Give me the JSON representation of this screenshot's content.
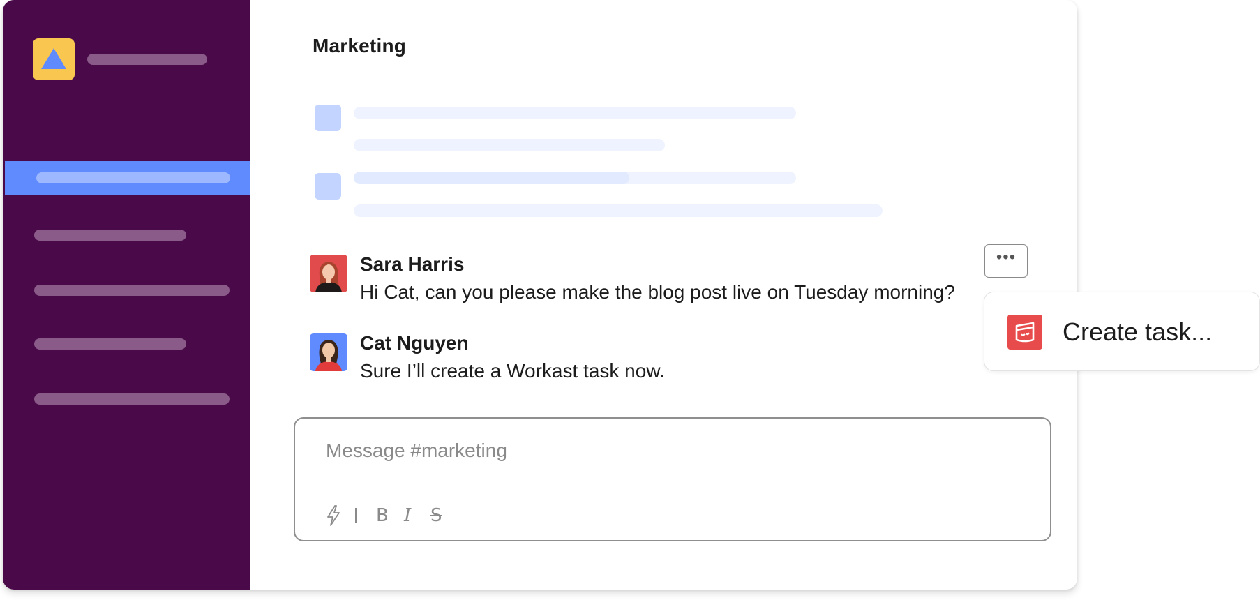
{
  "channel": {
    "title": "Marketing"
  },
  "messages": [
    {
      "author": "Sara Harris",
      "text": "Hi Cat, can you please make the blog post live on Tuesday morning?",
      "avatar_bg": "#e14b4b"
    },
    {
      "author": "Cat Nguyen",
      "text": "Sure I’ll create a Workast task now.",
      "avatar_bg": "#5f8bff"
    }
  ],
  "more_actions": {
    "label": "•••",
    "icon": "more-horizontal-icon"
  },
  "composer": {
    "placeholder": "Message #marketing",
    "tools": [
      {
        "icon": "lightning-icon"
      },
      {
        "icon": "divider"
      },
      {
        "label": "B",
        "icon": "bold-icon"
      },
      {
        "label": "I",
        "icon": "italic-icon"
      },
      {
        "label": "S",
        "icon": "strikethrough-icon"
      }
    ]
  },
  "popup": {
    "label": "Create task...",
    "icon": "workast-icon"
  },
  "colors": {
    "sidebar": "#4a0a49",
    "active_nav": "#5f8bff",
    "logo_tile": "#f9c74f",
    "logo_triangle": "#5f8bff",
    "skeleton": "#eef3ff",
    "skeleton_avatar": "#c2d4ff",
    "workast_red": "#e84b4b"
  }
}
